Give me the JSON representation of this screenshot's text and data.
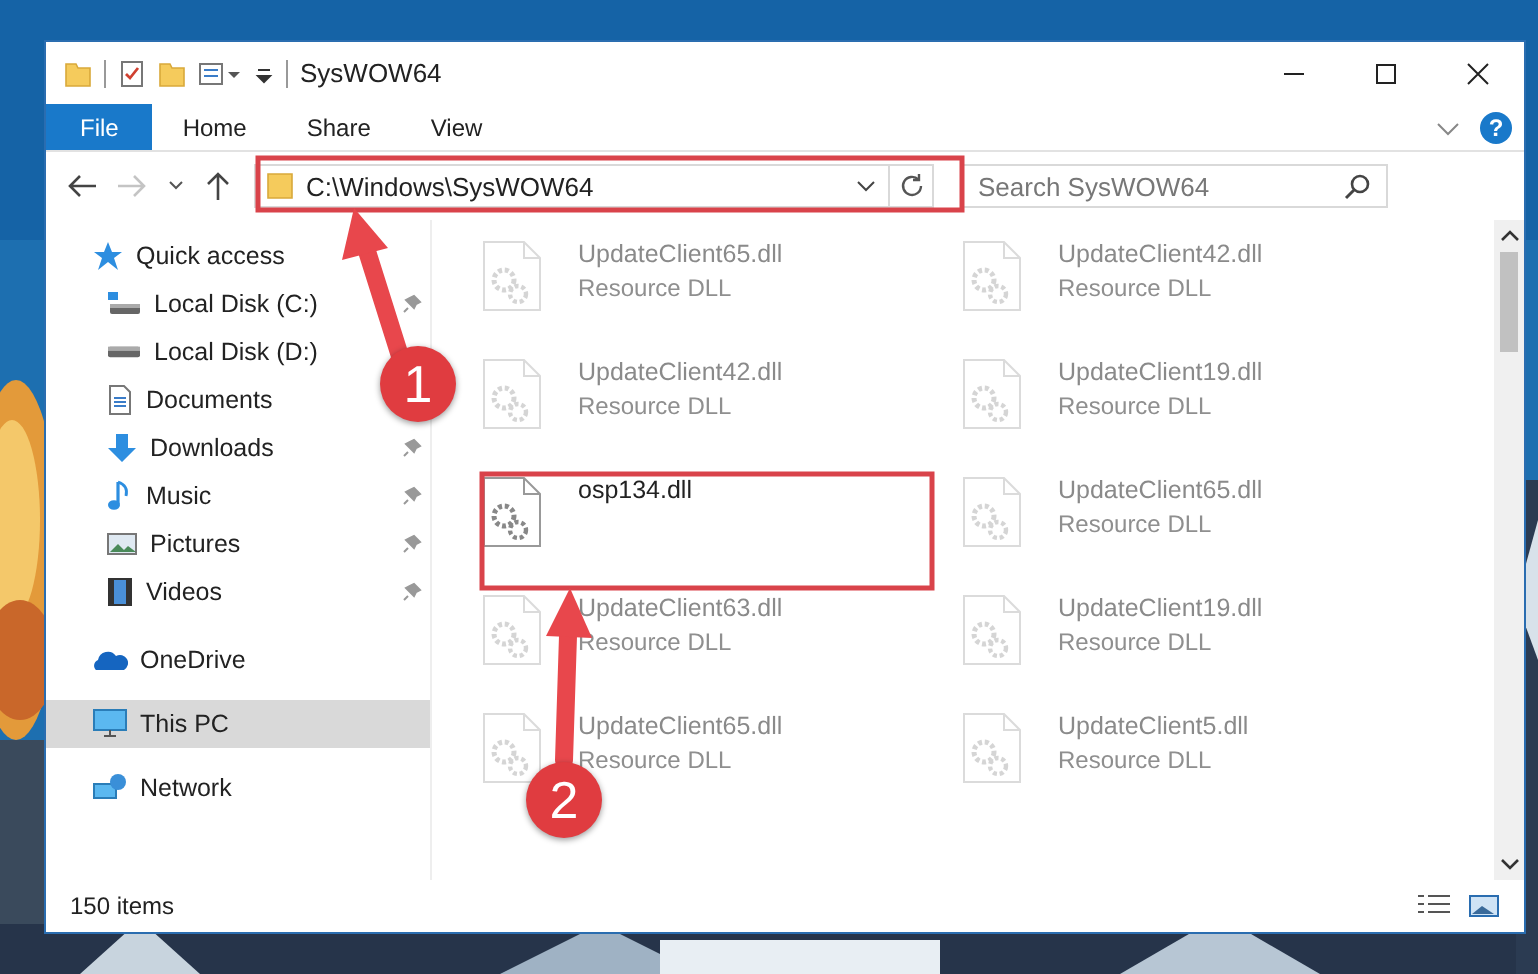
{
  "window": {
    "title": "SysWOW64"
  },
  "ribbon": {
    "tabs": [
      {
        "label": "File",
        "selected": true
      },
      {
        "label": "Home",
        "selected": false
      },
      {
        "label": "Share",
        "selected": false
      },
      {
        "label": "View",
        "selected": false
      }
    ],
    "help": "?"
  },
  "navigation": {
    "forward_disabled": true,
    "address": "C:\\Windows\\SysWOW64",
    "search": {
      "placeholder": "Search SysWOW64"
    }
  },
  "sidebar": {
    "items": [
      {
        "label": "Quick access",
        "kind": "star",
        "selected": false,
        "children": [
          {
            "label": "Local Disk (C:)",
            "kind": "system-drive",
            "pinned": true,
            "selected": false
          },
          {
            "label": "Local Disk (D:)",
            "kind": "drive",
            "pinned": false,
            "selected": false
          },
          {
            "label": "Documents",
            "kind": "documents",
            "pinned": false,
            "selected": false
          },
          {
            "label": "Downloads",
            "kind": "downloads",
            "pinned": true,
            "selected": false
          },
          {
            "label": "Music",
            "kind": "music",
            "pinned": true,
            "selected": false
          },
          {
            "label": "Pictures",
            "kind": "pictures",
            "pinned": true,
            "selected": false
          },
          {
            "label": "Videos",
            "kind": "videos",
            "pinned": true,
            "selected": false
          }
        ]
      },
      {
        "label": "OneDrive",
        "kind": "cloud",
        "selected": false
      },
      {
        "label": "This PC",
        "kind": "computer",
        "selected": true
      },
      {
        "label": "Network",
        "kind": "network",
        "selected": false
      }
    ]
  },
  "files": [
    {
      "name": "UpdateClient65.dll",
      "type": "Resource DLL",
      "dimmed": true
    },
    {
      "name": "UpdateClient42.dll",
      "type": "Resource DLL",
      "dimmed": true
    },
    {
      "name": "UpdateClient42.dll",
      "type": "Resource DLL",
      "dimmed": true
    },
    {
      "name": "UpdateClient19.dll",
      "type": "Resource DLL",
      "dimmed": true
    },
    {
      "name": "osp134.dll",
      "dimmed": false
    },
    {
      "name": "UpdateClient65.dll",
      "type": "Resource DLL",
      "dimmed": true
    },
    {
      "name": "UpdateClient63.dll",
      "type": "Resource DLL",
      "dimmed": true
    },
    {
      "name": "UpdateClient19.dll",
      "type": "Resource DLL",
      "dimmed": true
    },
    {
      "name": "UpdateClient65.dll",
      "type": "Resource DLL",
      "dimmed": true
    },
    {
      "name": "UpdateClient5.dll",
      "type": "Resource DLL",
      "dimmed": true
    }
  ],
  "status_bar": {
    "item_count": "150 items"
  },
  "callouts": [
    {
      "number": "1"
    },
    {
      "number": "2"
    }
  ]
}
